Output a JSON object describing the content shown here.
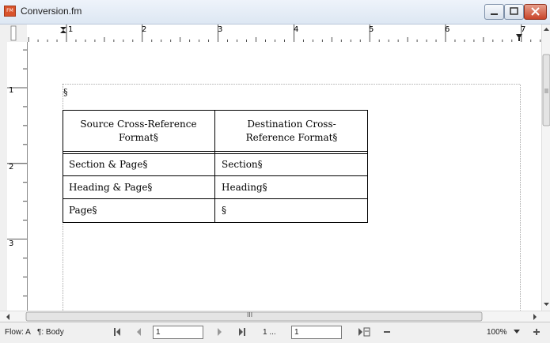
{
  "window": {
    "title": "Conversion.fm",
    "app_icon_text": "FM"
  },
  "ruler": {
    "h_labels": [
      "1",
      "2",
      "3",
      "4",
      "5",
      "6",
      "7"
    ],
    "v_labels": [
      "1",
      "2",
      "3"
    ]
  },
  "document": {
    "anchor_mark": "§",
    "table": {
      "headers": [
        "Source Cross-Reference Format§",
        "Destination Cross-Reference Format§"
      ],
      "header_lines": [
        [
          "Source Cross-Reference",
          "Format§"
        ],
        [
          "Destination Cross-",
          "Reference Format§"
        ]
      ],
      "rows": [
        [
          "Section & Page§",
          "Section§"
        ],
        [
          "Heading & Page§",
          "Heading§"
        ],
        [
          "Page§",
          "§"
        ]
      ]
    }
  },
  "hscroll": {
    "grip": "III"
  },
  "statusbar": {
    "flow": "Flow: A",
    "para_tag": "¶: Body",
    "page_field": "1",
    "page_of": "1 ...",
    "goto_field": "1",
    "zoom": "100%"
  }
}
